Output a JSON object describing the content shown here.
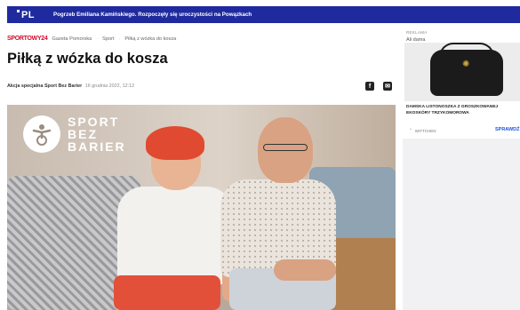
{
  "topbar": {
    "logo": "PL",
    "headline": "Pogrzeb Emiliana Kamińskiego. Rozpoczęły się uroczystości na Powązkach"
  },
  "breadcrumb": {
    "brand": "SPORTOWY24",
    "items": [
      "Gazeta Pomorska",
      "Sport",
      "Piłką z wózka do kosza"
    ]
  },
  "article": {
    "title": "Piłką z wózka do kosza",
    "author": "Akcja specjalna Sport Bez Barier",
    "date": "16 grudnia 2022, 12:12",
    "share": [
      "f",
      "✉"
    ]
  },
  "photo": {
    "overlay_logo_line1": "SPORT",
    "overlay_logo_line2": "BEZ",
    "overlay_logo_line3": "BARIER"
  },
  "ad": {
    "label": "REKLAMA",
    "tag": "Ali dama",
    "title": "DAMSKA LISTONOSZKA Z GROSZKOWANEJ EKOSKÓRY TRZYKOMOROWA",
    "brand": "WITTCHEN",
    "cta": "SPRAWDŹ"
  }
}
